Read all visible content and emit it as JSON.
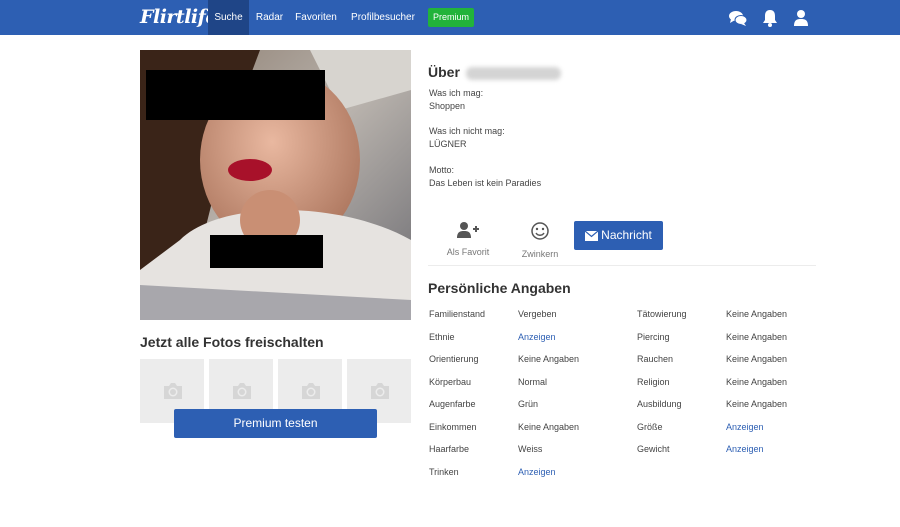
{
  "nav": {
    "logo": "Flirtlife",
    "items": [
      "Suche",
      "Radar",
      "Favoriten",
      "Profilbesucher"
    ],
    "premium": "Premium",
    "icons": [
      "chat-icon",
      "bell-icon",
      "user-icon"
    ],
    "colors": {
      "bar": "#2d5fb3",
      "active": "#1f4587",
      "premium": "#22b33a"
    }
  },
  "left": {
    "unlock_title": "Jetzt alle Fotos freischalten",
    "premium_button": "Premium testen"
  },
  "about": {
    "title_prefix": "Über",
    "likes_label": "Was ich mag:",
    "likes_value": "Shoppen",
    "dislikes_label": "Was ich nicht mag:",
    "dislikes_value": "LÜGNER",
    "motto_label": "Motto:",
    "motto_value": "Das Leben ist kein Paradies"
  },
  "actions": {
    "favorite": "Als Favorit",
    "wink": "Zwinkern",
    "message": "Nachricht"
  },
  "personal": {
    "title": "Persönliche Angaben",
    "left": [
      {
        "label": "Familienstand",
        "value": "Vergeben",
        "link": false
      },
      {
        "label": "Ethnie",
        "value": "Anzeigen",
        "link": true
      },
      {
        "label": "Orientierung",
        "value": "Keine Angaben",
        "link": false
      },
      {
        "label": "Körperbau",
        "value": "Normal",
        "link": false
      },
      {
        "label": "Augenfarbe",
        "value": "Grün",
        "link": false
      },
      {
        "label": "Einkommen",
        "value": "Keine Angaben",
        "link": false
      },
      {
        "label": "Haarfarbe",
        "value": "Weiss",
        "link": false
      },
      {
        "label": "Trinken",
        "value": "Anzeigen",
        "link": true
      }
    ],
    "right": [
      {
        "label": "Tätowierung",
        "value": "Keine Angaben",
        "link": false
      },
      {
        "label": "Piercing",
        "value": "Keine Angaben",
        "link": false
      },
      {
        "label": "Rauchen",
        "value": "Keine Angaben",
        "link": false
      },
      {
        "label": "Religion",
        "value": "Keine Angaben",
        "link": false
      },
      {
        "label": "Ausbildung",
        "value": "Keine Angaben",
        "link": false
      },
      {
        "label": "Größe",
        "value": "Anzeigen",
        "link": true
      },
      {
        "label": "Gewicht",
        "value": "Anzeigen",
        "link": true
      }
    ]
  }
}
